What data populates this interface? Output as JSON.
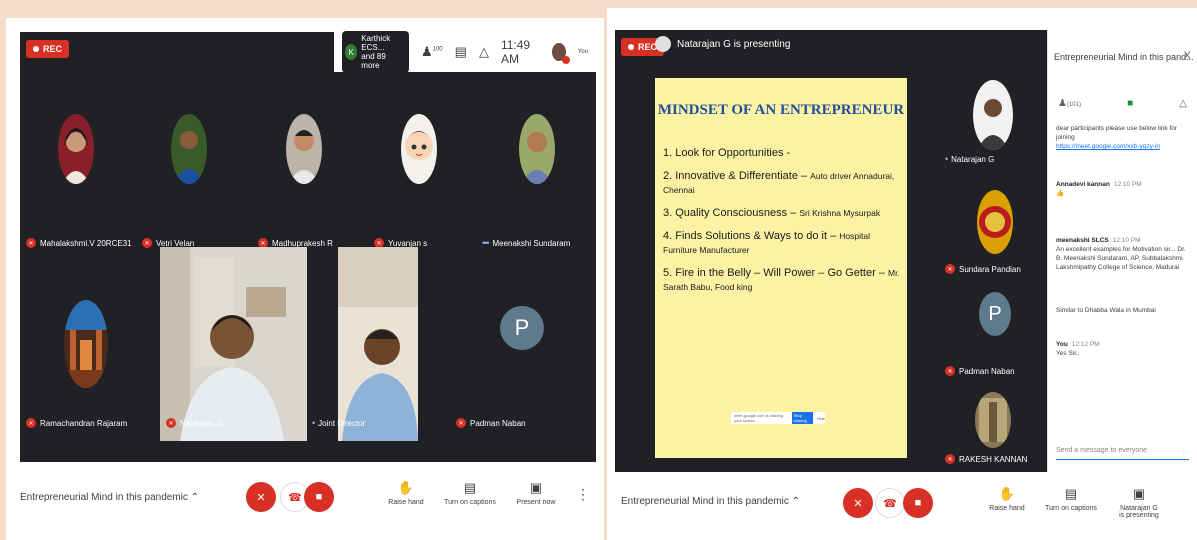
{
  "left": {
    "rec_label": "REC",
    "chip_initial": "K",
    "chip_line1": "Karthick ECS...",
    "chip_line2": "and 89 more",
    "people_count": "100",
    "clock": "11:49 AM",
    "you_label": "You",
    "tiles_row1": [
      {
        "name": "Mahalakshmi.V 20RCE31",
        "muted": true
      },
      {
        "name": "Vetri Velan",
        "muted": true
      },
      {
        "name": "Madhuprakesh R",
        "muted": true
      },
      {
        "name": "Yuvanjan s",
        "muted": true
      },
      {
        "name": "Meenakshi Sundaram",
        "muted": false
      }
    ],
    "tiles_row2": [
      {
        "name": "Ramachandran Rajaram",
        "muted": true
      },
      {
        "name": "Natarajan G",
        "muted": true
      },
      {
        "name": "Joint Director",
        "muted": false
      },
      {
        "name": "Padman Naban",
        "muted": true
      }
    ],
    "p_initial": "P",
    "meeting_title": "Entrepreneurial Mind in this pandemic",
    "raise_hand": "Raise hand",
    "captions": "Turn on captions",
    "present": "Present now"
  },
  "right": {
    "rec_label": "REC",
    "presenting": "Natarajan G is presenting",
    "slide": {
      "title": "MINDSET OF AN ENTREPRENEUR",
      "items": [
        {
          "main": "1. Look for Opportunities -",
          "detail": ""
        },
        {
          "main": "2. Innovative & Differentiate – ",
          "detail": "Auto driver Annadurai, Chennai"
        },
        {
          "main": "3. Quality Consciousness – ",
          "detail": "Sri Krishna Mysurpak"
        },
        {
          "main": "4. Finds Solutions & Ways to do it – ",
          "detail": "Hospital Furniture Manufacturer"
        },
        {
          "main": "5. Fire in the Belly – Will Power – Go Getter – ",
          "detail": "Mr. Sarath Babu, Food king"
        }
      ],
      "share_text": "meet.google.com is sharing your screen",
      "stop_label": "Stop sharing",
      "hide_label": "Hide"
    },
    "side_tiles": [
      {
        "name": "Natarajan G",
        "muted": false
      },
      {
        "name": "Sundara Pandian",
        "muted": true
      },
      {
        "name": "Padman Naban",
        "muted": true
      },
      {
        "name": "RAKESH KANNAN",
        "muted": true
      }
    ],
    "p_initial": "P",
    "panel": {
      "title": "Entrepreneurial Mind in this pand...",
      "close": "X",
      "people_count": "(101)",
      "messages": [
        {
          "who": "",
          "time": "",
          "text": "dear participants please use below link for joining",
          "link": "https://meet.google.com/xxb-yqzy-in"
        },
        {
          "who": "Annadevi kannan",
          "time": "12:10 PM",
          "text": "👍",
          "link": ""
        },
        {
          "who": "meenakshi SLCS",
          "time": "12:10 PM",
          "text": "An excellent examples for Motivation sir... Dr. B. Meenakshi Sundaram, AP, Subbalakshmi Lakshmipathy College of Science, Madurai",
          "link": ""
        },
        {
          "who": "",
          "time": "",
          "text": "Similar to Dhabba Wala in Mumbai",
          "link": ""
        },
        {
          "who": "You",
          "time": "12:12 PM",
          "text": "Yes Sir..",
          "link": ""
        }
      ],
      "send_placeholder": "Send a message to everyone"
    },
    "meeting_title": "Entrepreneurial Mind in this pandemic",
    "raise_hand": "Raise hand",
    "captions": "Turn on captions",
    "presenting_line1": "Natarajan G",
    "presenting_line2": "is presenting"
  }
}
